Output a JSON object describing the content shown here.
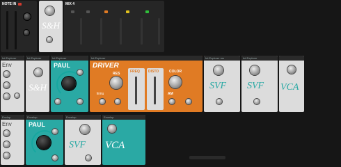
{
  "note_in": {
    "title": "NOTE IN",
    "shortname": "S&H"
  },
  "mix": {
    "title": "MIX 4"
  },
  "row1": {
    "labels": [
      "Int Explorer",
      "Int Explorer",
      "Int Explorer",
      "Int Explorer",
      "Int Explorer ms",
      "Int Explorer"
    ],
    "env_title": "Env",
    "paul_title": "PAUL",
    "driver_title": "DRIVER",
    "res_label": "RES",
    "freq_label": "FREQ",
    "disto_label": "DISTO",
    "color_label": "COLOR",
    "emu_label": "Emu",
    "am_label": "AM",
    "svf1_title": "SVF",
    "svf2_title": "SVF",
    "vca_title": "VCA",
    "sh_title": "S&H"
  },
  "row2": {
    "labels": [
      "Envlop",
      "Envelop",
      "Envelop",
      "Envelop"
    ],
    "env_title": "Env",
    "paul_title": "PAUL",
    "svf_title": "SVF",
    "vca_title": "VCA"
  },
  "colors": {
    "teal": "#2aa9a4",
    "orange": "#e07b24",
    "red": "#d23a2f",
    "green": "#2fbf3a",
    "yellow": "#e2c21e"
  }
}
